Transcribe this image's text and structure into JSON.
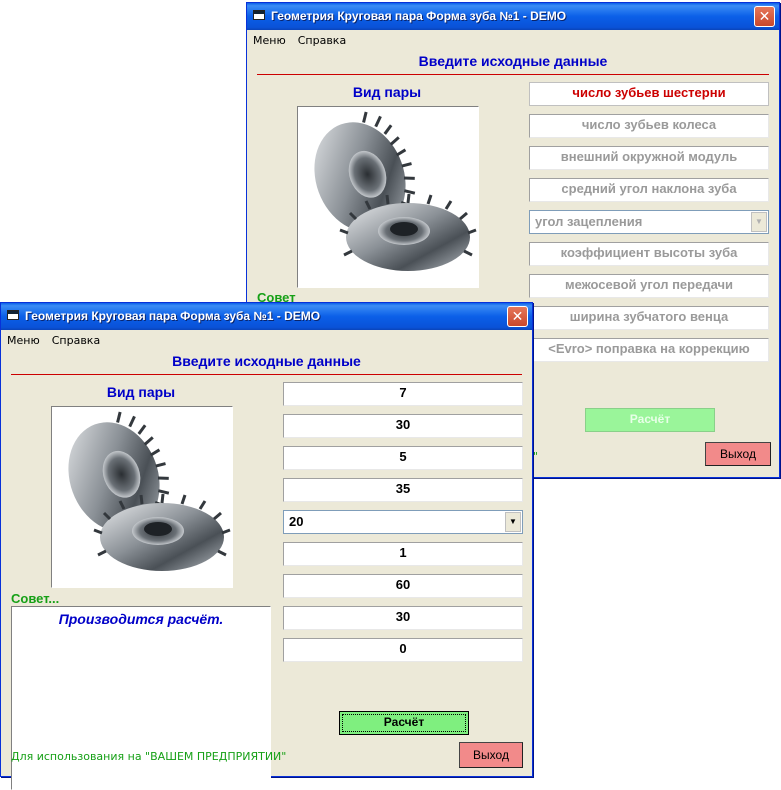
{
  "back_window": {
    "title": "Геометрия Круговая пара Форма зуба №1 - DEMO",
    "menu": [
      "Меню",
      "Справка"
    ],
    "heading": "Введите исходные данные",
    "pair_label": "Вид пары",
    "fields": [
      "число зубьев шестерни",
      "число зубьев колеса",
      "внешний окружной модуль",
      "средний угол наклона зуба",
      "угол зацепления",
      "коэффициент высоты зуба",
      "межосевой угол передачи",
      "ширина зубчатого венца",
      "<Evro> поправка на коррекцию"
    ],
    "sovet_label": "Совет",
    "footer_fragment": "\"",
    "calc_label": "Расчёт",
    "exit_label": "Выход"
  },
  "front_window": {
    "title": "Геометрия Круговая пара Форма зуба №1 - DEMO",
    "menu": [
      "Меню",
      "Справка"
    ],
    "heading": "Введите исходные данные",
    "pair_label": "Вид пары",
    "values": [
      "7",
      "30",
      "5",
      "35",
      "20",
      "1",
      "60",
      "30",
      "0"
    ],
    "sovet_label": "Совет...",
    "advice_text": "Производится расчёт.",
    "calc_label": "Расчёт",
    "exit_label": "Выход",
    "footer": "Для использования на  \"ВАШЕМ ПРЕДПРИЯТИИ\""
  },
  "icons": {
    "app": "window-app-icon",
    "close": "close-icon",
    "dropdown": "chevron-down-icon",
    "gear": "bevel-gear-pair-image"
  },
  "colors": {
    "title_bar": "#0a5ee8",
    "heading_blue": "#0000c8",
    "divider_red": "#cc0000",
    "active_hint_red": "#cc0000",
    "calc_green": "#7fef7f",
    "exit_red": "#f28a8a",
    "sovet_green": "#16a016"
  }
}
